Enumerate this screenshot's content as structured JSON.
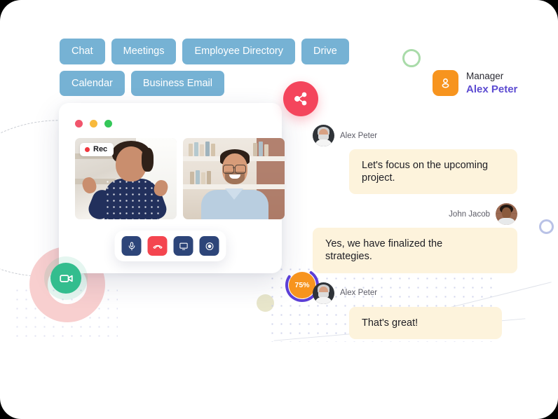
{
  "nav": {
    "rows": [
      [
        {
          "label": "Chat",
          "name": "nav-pill-chat"
        },
        {
          "label": "Meetings",
          "name": "nav-pill-meetings"
        },
        {
          "label": "Employee Directory",
          "name": "nav-pill-employee-directory"
        },
        {
          "label": "Drive",
          "name": "nav-pill-drive"
        }
      ],
      [
        {
          "label": "Calendar",
          "name": "nav-pill-calendar"
        },
        {
          "label": "Business Email",
          "name": "nav-pill-business-email"
        }
      ]
    ]
  },
  "manager": {
    "role": "Manager",
    "name": "Alex Peter",
    "avatar_icon": "person-icon",
    "badge_color": "#f7941e",
    "name_color": "#5c4bd1"
  },
  "call": {
    "window_dots": [
      "red",
      "amber",
      "green"
    ],
    "recording": {
      "label": "Rec",
      "dot_color": "#f0353d"
    },
    "tiles": [
      {
        "name": "video-tile-self",
        "participant": "woman-waving"
      },
      {
        "name": "video-tile-peer",
        "participant": "man-with-glasses"
      }
    ],
    "controls": [
      {
        "name": "mic-button",
        "icon": "microphone-icon",
        "color": "#2d4579"
      },
      {
        "name": "hangup-button",
        "icon": "phone-hangup-icon",
        "color": "#f4454f"
      },
      {
        "name": "screen-share-button",
        "icon": "monitor-icon",
        "color": "#2d4579"
      },
      {
        "name": "record-button",
        "icon": "record-dot-icon",
        "color": "#2d4579"
      }
    ]
  },
  "fabs": {
    "share": {
      "name": "share-fab",
      "icon": "share-nodes-icon",
      "color": "#f4455c"
    },
    "camera": {
      "name": "camera-fab",
      "icon": "video-camera-icon",
      "color": "#33bd8e"
    }
  },
  "progress": {
    "label": "75%",
    "value": 75,
    "track_color": "#5c3fd6",
    "fill_color": "#f7941e"
  },
  "chat": {
    "messages": [
      {
        "author": "Alex Peter",
        "text": "Let's focus on the upcoming project.",
        "side": "left",
        "avatar": "alex"
      },
      {
        "author": "John Jacob",
        "text": "Yes, we have finalized the strategies.",
        "side": "right",
        "avatar": "john"
      },
      {
        "author": "Alex Peter",
        "text": "That's great!",
        "side": "left",
        "avatar": "alex"
      }
    ],
    "bubble_color": "#fdf3dc"
  },
  "decor": {
    "ring_green_color": "#a9dba9",
    "ring_blue_color": "#b9c2e6",
    "khaki_dot_color": "#e8e6cb",
    "pink_donut_color": "#f8cfcf",
    "pill_color": "#76b2d4"
  }
}
